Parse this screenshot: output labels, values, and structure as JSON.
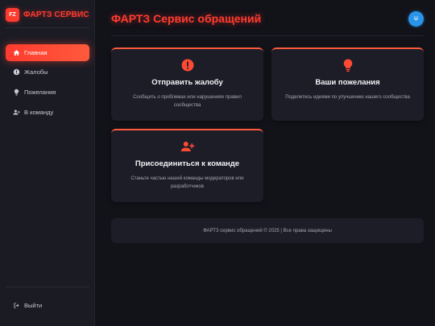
{
  "brand": {
    "logo_text": "FZ",
    "name": "ФАРТЗ СЕРВИС"
  },
  "sidebar": {
    "items": [
      {
        "label": "Главная",
        "icon": "home-icon",
        "active": true
      },
      {
        "label": "Жалобы",
        "icon": "alert-circle-icon",
        "active": false
      },
      {
        "label": "Пожелания",
        "icon": "lightbulb-icon",
        "active": false
      },
      {
        "label": "В команду",
        "icon": "user-plus-icon",
        "active": false
      }
    ],
    "logout": {
      "label": "Выйти",
      "icon": "logout-icon"
    }
  },
  "header": {
    "title": "ФАРТЗ Сервис обращений",
    "avatar_letter": "U"
  },
  "cards": [
    {
      "title": "Отправить жалобу",
      "description": "Сообщить о проблемах или нарушениях правил сообщества",
      "icon": "alert-circle-icon"
    },
    {
      "title": "Ваши пожелания",
      "description": "Поделитесь идеями по улучшению нашего сообщества",
      "icon": "lightbulb-icon"
    },
    {
      "title": "Присоединиться к команде",
      "description": "Станьте частью нашей команды модераторов или разработчиков",
      "icon": "user-plus-icon"
    }
  ],
  "footer": {
    "text": "ФАРТЗ сервис обращений © 2025 | Все права защищены"
  },
  "colors": {
    "accent": "#ff3b2f",
    "avatar": "#2a95e8",
    "background": "#121219",
    "card": "#1d1d27",
    "sidebar": "#1b1b24"
  }
}
